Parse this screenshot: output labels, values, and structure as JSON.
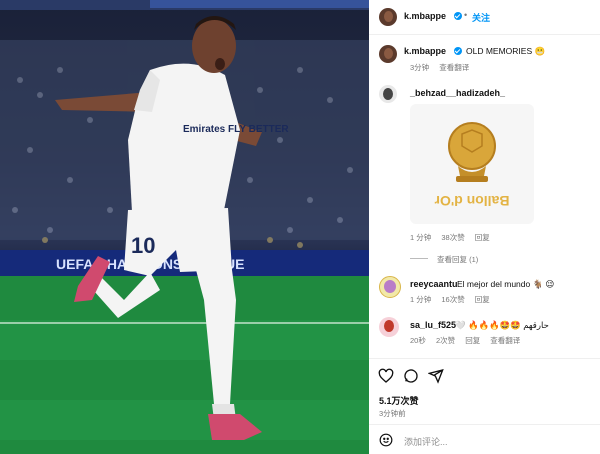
{
  "post": {
    "author": "k.mbappe",
    "follow_label": "关注",
    "caption": "OLD MEMORIES 😬",
    "caption_time": "3分钟",
    "caption_translate": "查看翻译",
    "photo": {
      "jersey_text": "Emirates FLY BETTER",
      "shirt_number": "10",
      "board_text": "UEFA CHAMPIONS LEAGUE"
    }
  },
  "comments": [
    {
      "user": "_behzad__hadizadeh_",
      "gif_text": "Ballon d'Or",
      "time": "1 分钟",
      "likes": "38次赞",
      "reply": "回复",
      "view_replies": "查看回复 (1)"
    },
    {
      "user": "reeycaantu",
      "text": "El mejor del mundo 🐐 😉",
      "time": "1 分钟",
      "likes": "16次赞",
      "reply": "回复"
    },
    {
      "user": "sa_lu_f525",
      "text": "🤍 🔥🔥🔥🤩🤩 حارقهم",
      "time": "20秒",
      "likes": "2次赞",
      "reply": "回复",
      "translate": "查看翻译"
    }
  ],
  "footer": {
    "like_count": "5.1万次赞",
    "time": "3分钟前",
    "comment_placeholder": "添加评论..."
  },
  "icons": {
    "like": "heart-icon",
    "comment": "comment-icon",
    "share": "share-icon",
    "emoji": "emoji-icon"
  },
  "colors": {
    "accent": "#0095f6",
    "real_madrid_white": "#ffffff",
    "pitch": "#1f8a3f"
  }
}
